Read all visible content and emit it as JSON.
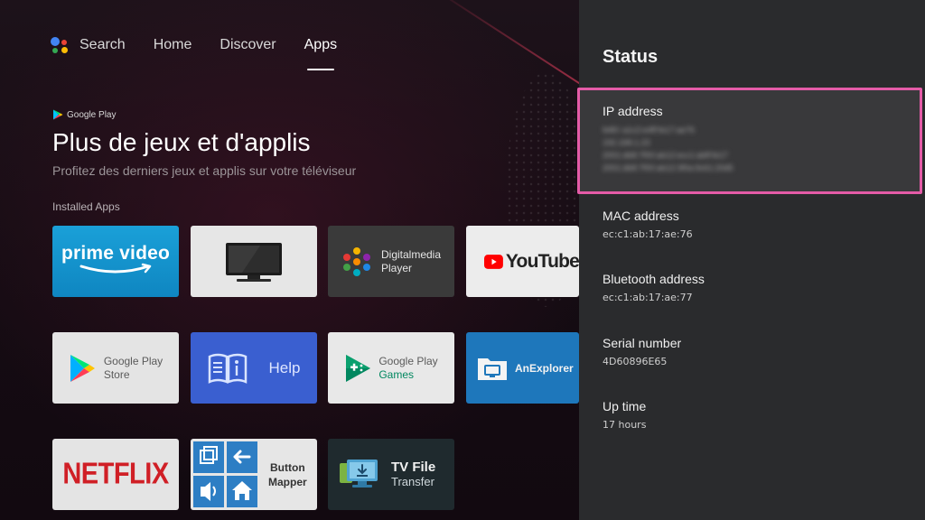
{
  "nav": {
    "search": "Search",
    "home": "Home",
    "discover": "Discover",
    "apps": "Apps"
  },
  "banner": {
    "brand": "Google Play",
    "title": "Plus de jeux et d'applis",
    "subtitle": "Profitez des derniers jeux et applis sur votre téléviseur"
  },
  "section_label": "Installed Apps",
  "apps": {
    "prime": "prime video",
    "dmp_line1": "Digitalmedia",
    "dmp_line2": "Player",
    "youtube": "YouTube",
    "play_line1": "Google Play",
    "play_line2": "Store",
    "help": "Help",
    "games_line1": "Google Play",
    "games_line2": "Games",
    "anex": "AnExplorer",
    "netflix": "NETFLIX",
    "mapper_line1": "Button",
    "mapper_line2": "Mapper",
    "tvfile_line1": "TV File",
    "tvfile_line2": "Transfer"
  },
  "panel": {
    "title": "Status",
    "ip_label": "IP address",
    "ip_lines": [
      "fe80::a1c2:e4ff:fe17:ae76",
      "192.168.1.23",
      "2001:db8:7f00:ab12:ecc1:abff:fe17",
      "2001:db8:7f00:ab12:3f0a:9c61:20d5"
    ],
    "mac_label": "MAC address",
    "mac_value": "ec:c1:ab:17:ae:76",
    "bt_label": "Bluetooth address",
    "bt_value": "ec:c1:ab:17:ae:77",
    "serial_label": "Serial number",
    "serial_value": "4D60896E65",
    "uptime_label": "Up time",
    "uptime_value": "17 hours"
  },
  "colors": {
    "panel_bg": "#2a2b2d",
    "focus_border": "#e45ba7",
    "prime_blue": "#1aa0d8",
    "youtube_red": "#ff0000",
    "netflix_red": "#d01f26"
  }
}
